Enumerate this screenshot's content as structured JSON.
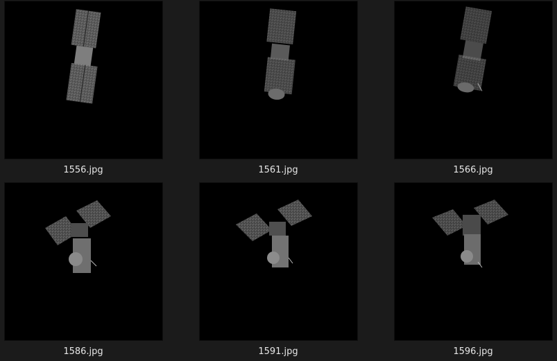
{
  "files": [
    {
      "name": "1556.jpg",
      "thumbnail": "satellite-render-thumbnail"
    },
    {
      "name": "1561.jpg",
      "thumbnail": "satellite-render-thumbnail"
    },
    {
      "name": "1566.jpg",
      "thumbnail": "satellite-render-thumbnail"
    },
    {
      "name": "1586.jpg",
      "thumbnail": "satellite-render-thumbnail"
    },
    {
      "name": "1591.jpg",
      "thumbnail": "satellite-render-thumbnail"
    },
    {
      "name": "1596.jpg",
      "thumbnail": "satellite-render-thumbnail"
    }
  ],
  "colors": {
    "background": "#1b1b1b",
    "thumbnail_background": "#000000",
    "label_text": "#e6e6e6"
  }
}
